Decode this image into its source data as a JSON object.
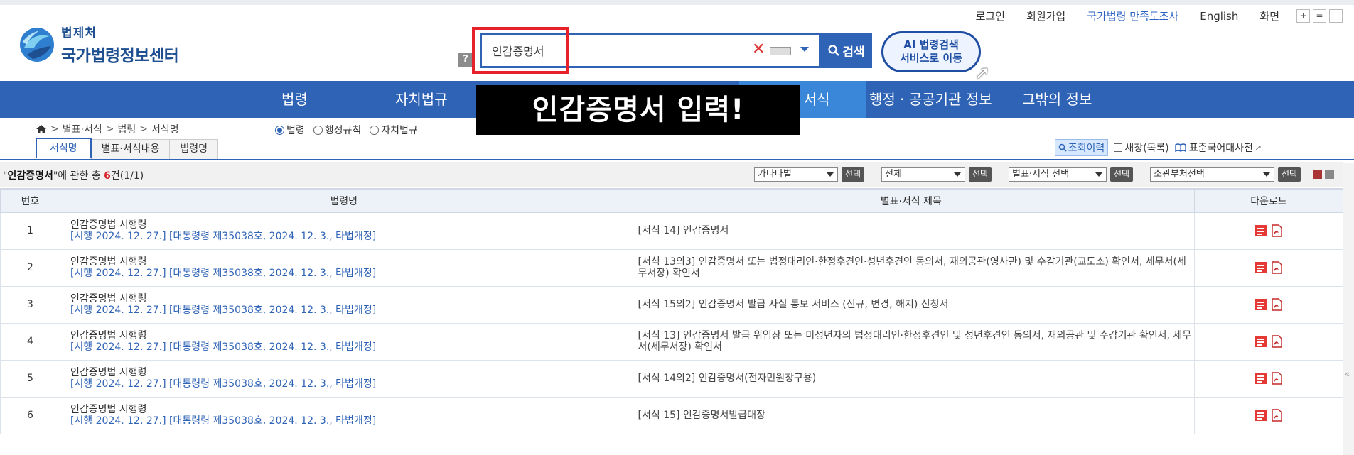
{
  "util": {
    "login": "로그인",
    "signup": "회원가입",
    "survey": "국가법령 만족도조사",
    "english": "English",
    "screen": "화면",
    "zoom_in": "+",
    "zoom_reset": "=",
    "zoom_out": "-"
  },
  "logo": {
    "sub": "법제처",
    "main": "국가법령정보센터"
  },
  "search": {
    "help": "?",
    "value": "인감증명서",
    "button": "검색"
  },
  "ai_button": {
    "line1": "AI 법령검색",
    "line2": "서비스로 이동"
  },
  "nav": {
    "items": [
      "법령",
      "자치법규",
      "· 서식",
      "행정 · 공공기관 정보",
      "그밖의 정보"
    ]
  },
  "overlay": "인감증명서 입력!",
  "breadcrumb": [
    "별표·서식",
    "법령",
    "서식명"
  ],
  "radios": [
    {
      "label": "법령",
      "checked": true
    },
    {
      "label": "행정규칙",
      "checked": false
    },
    {
      "label": "자치법규",
      "checked": false
    }
  ],
  "tabs": [
    "서식명",
    "별표·서식내용",
    "법령명"
  ],
  "tools": {
    "history": "조회이력",
    "newwin": "새창(목록)",
    "dict": "표준국어대사전"
  },
  "result": {
    "keyword": "인감증명서",
    "prefix": "\"",
    "mid": "\"에 관한 총 ",
    "count": "6",
    "suffix": "건(1/1)"
  },
  "filters": {
    "sort": "가나다별",
    "type": "전체",
    "form": "별표·서식 선택",
    "dept": "소관부처선택",
    "btn": "선택"
  },
  "table": {
    "headers": [
      "번호",
      "법령명",
      "별표·서식 제목",
      "다운로드"
    ],
    "rows": [
      {
        "no": "1",
        "law": "인감증명법 시행령",
        "detail": "[시행 2024. 12. 27.] [대통령령 제35038호, 2024. 12. 3., 타법개정]",
        "title": "[서식 14] 인감증명서"
      },
      {
        "no": "2",
        "law": "인감증명법 시행령",
        "detail": "[시행 2024. 12. 27.] [대통령령 제35038호, 2024. 12. 3., 타법개정]",
        "title": "[서식 13의3] 인감증명서 또는 법정대리인·한정후견인·성년후견인 동의서, 재외공관(영사관) 및 수감기관(교도소) 확인서, 세무서(세무서장) 확인서"
      },
      {
        "no": "3",
        "law": "인감증명법 시행령",
        "detail": "[시행 2024. 12. 27.] [대통령령 제35038호, 2024. 12. 3., 타법개정]",
        "title": "[서식 15의2] 인감증명서 발급 사실 통보 서비스 (신규, 변경, 해지) 신청서"
      },
      {
        "no": "4",
        "law": "인감증명법 시행령",
        "detail": "[시행 2024. 12. 27.] [대통령령 제35038호, 2024. 12. 3., 타법개정]",
        "title": "[서식 13] 인감증명서 발급 위임장 또는 미성년자의 법정대리인·한정후견인 및 성년후견인 동의서, 재외공관 및 수감기관 확인서, 세무서(세무서장) 확인서"
      },
      {
        "no": "5",
        "law": "인감증명법 시행령",
        "detail": "[시행 2024. 12. 27.] [대통령령 제35038호, 2024. 12. 3., 타법개정]",
        "title": "[서식 14의2] 인감증명서(전자민원창구용)"
      },
      {
        "no": "6",
        "law": "인감증명법 시행령",
        "detail": "[시행 2024. 12. 27.] [대통령령 제35038호, 2024. 12. 3., 타법개정]",
        "title": "[서식 15] 인감증명서발급대장"
      }
    ]
  },
  "colors": {
    "brand": "#2f63b6",
    "highlight": "#e8202a",
    "accent_count": "#d8232a"
  }
}
